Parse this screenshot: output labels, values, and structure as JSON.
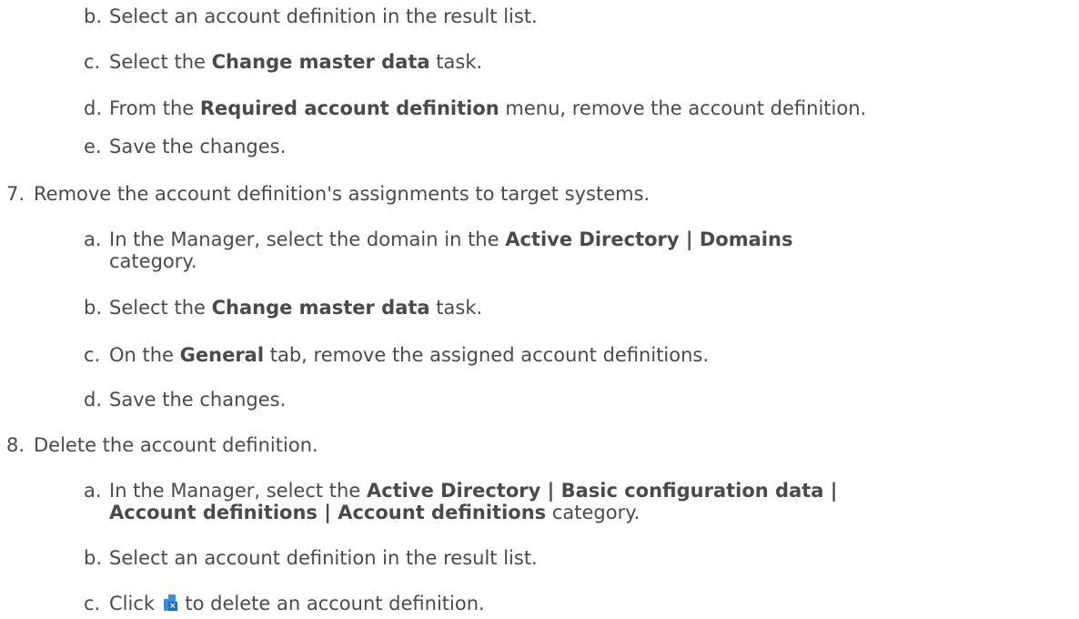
{
  "steps": {
    "step6_tail": {
      "b": {
        "letter": "b.",
        "text": "Select an account definition in the result list."
      },
      "c": {
        "letter": "c.",
        "pre": "Select the ",
        "bold": "Change master data",
        "post": " task."
      },
      "d": {
        "letter": "d.",
        "pre": "From the ",
        "bold": "Required account definition",
        "post": " menu, remove the account definition."
      },
      "e": {
        "letter": "e.",
        "text": "Save the changes."
      }
    },
    "step7": {
      "number": "7.",
      "text": "Remove the account definition's assignments to target systems.",
      "a": {
        "letter": "a.",
        "pre": "In the Manager, select the domain in the ",
        "bold": "Active Directory | Domains",
        "post": "category."
      },
      "b": {
        "letter": "b.",
        "pre": "Select the ",
        "bold": "Change master data",
        "post": " task."
      },
      "c": {
        "letter": "c.",
        "pre": "On the ",
        "bold": "General",
        "post": " tab, remove the assigned account definitions."
      },
      "d": {
        "letter": "d.",
        "text": "Save the changes."
      }
    },
    "step8": {
      "number": "8.",
      "text": "Delete the account definition.",
      "a": {
        "letter": "a.",
        "pre": "In the Manager, select the ",
        "bold1": "Active Directory | Basic configuration data |",
        "bold2": "Account definitions | Account definitions",
        "post": " category."
      },
      "b": {
        "letter": "b.",
        "text": "Select an account definition in the result list."
      },
      "c": {
        "letter": "c.",
        "pre": "Click ",
        "icon": "delete-document-icon",
        "post": " to delete an account definition."
      }
    }
  }
}
